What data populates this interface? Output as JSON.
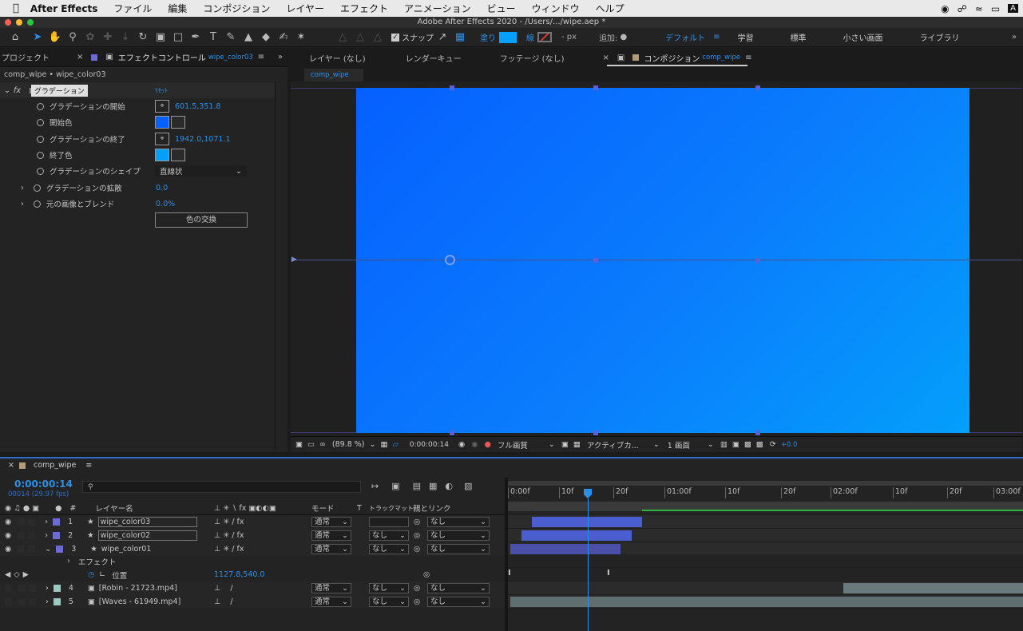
{
  "menubar": {
    "apple": "",
    "app": "After Effects",
    "items": [
      "ファイル",
      "編集",
      "コンポジション",
      "レイヤー",
      "エフェクト",
      "アニメーション",
      "ビュー",
      "ウィンドウ",
      "ヘルプ"
    ],
    "status": "A"
  },
  "titlebar": {
    "title": "Adobe After Effects 2020 - /Users/.../wipe.aep *"
  },
  "toolbar": {
    "snap": "スナップ",
    "fill": "塗り",
    "stroke": "線",
    "px": "- px",
    "add": "追加:",
    "workspaces": [
      "デフォルト",
      "学習",
      "標準",
      "小さい画面",
      "ライブラリ"
    ]
  },
  "left_panel": {
    "tab_project": "プロジェクト",
    "tab_effects": "エフェクトコントロール",
    "tab_effects_layer": "wipe_color03",
    "breadcrumb": "comp_wipe • wipe_color03",
    "effect_name": "グラデーション",
    "reset": "ﾘｾｯﾄ",
    "props": [
      {
        "label": "グラデーションの開始",
        "value": "601.5,351.8"
      },
      {
        "label": "開始色",
        "value": ""
      },
      {
        "label": "グラデーションの終了",
        "value": "1942.0,1071.1"
      },
      {
        "label": "終了色",
        "value": ""
      },
      {
        "label": "グラデーションのシェイプ",
        "value": "直線状"
      },
      {
        "label": "グラデーションの拡散",
        "value": "0.0"
      },
      {
        "label": "元の画像とブレンド",
        "value": "0.0%"
      }
    ],
    "swap_button": "色の交換",
    "start_color": "#0660ff",
    "end_color": "#049ffb"
  },
  "viewer": {
    "tabs": [
      "レイヤー (なし)",
      "レンダーキュー",
      "フッテージ (なし)"
    ],
    "comp_tab": "コンポジション",
    "comp_name": "comp_wipe",
    "subtab": "comp_wipe",
    "zoom": "(89.8 %)",
    "timecode": "0:00:00:14",
    "quality": "フル画質",
    "camera": "アクティブカ...",
    "views": "1 画面",
    "exposure": "+0.0"
  },
  "timeline": {
    "comp_tab": "comp_wipe",
    "timecode": "0:00:00:14",
    "fps": "00014 (29.97 fps)",
    "search_placeholder": "",
    "col_layer": "レイヤー名",
    "col_mode": "モード",
    "col_t": "T",
    "col_track": "トラックマット",
    "col_parent": "親とリンク",
    "ruler": [
      "0:00f",
      "10f",
      "20f",
      "01:00f",
      "10f",
      "20f",
      "02:00f",
      "10f",
      "20f",
      "03:00f"
    ],
    "layers": [
      {
        "num": "1",
        "name": "wipe_color03",
        "mode": "通常",
        "track": "",
        "parent": "なし",
        "color": "#6b6bd6"
      },
      {
        "num": "2",
        "name": "wipe_color02",
        "mode": "通常",
        "track": "なし",
        "parent": "なし",
        "color": "#6b6bd6"
      },
      {
        "num": "3",
        "name": "wipe_color01",
        "mode": "通常",
        "track": "なし",
        "parent": "なし",
        "color": "#6b6bd6"
      },
      {
        "num": "4",
        "name": "[Robin - 21723.mp4]",
        "mode": "通常",
        "track": "なし",
        "parent": "なし",
        "color": "#9ec9c0"
      },
      {
        "num": "5",
        "name": "[Waves - 61949.mp4]",
        "mode": "通常",
        "track": "なし",
        "parent": "なし",
        "color": "#9ec9c0"
      }
    ],
    "effects_label": "エフェクト",
    "position_label": "位置",
    "position_value": "1127.8,540.0"
  }
}
